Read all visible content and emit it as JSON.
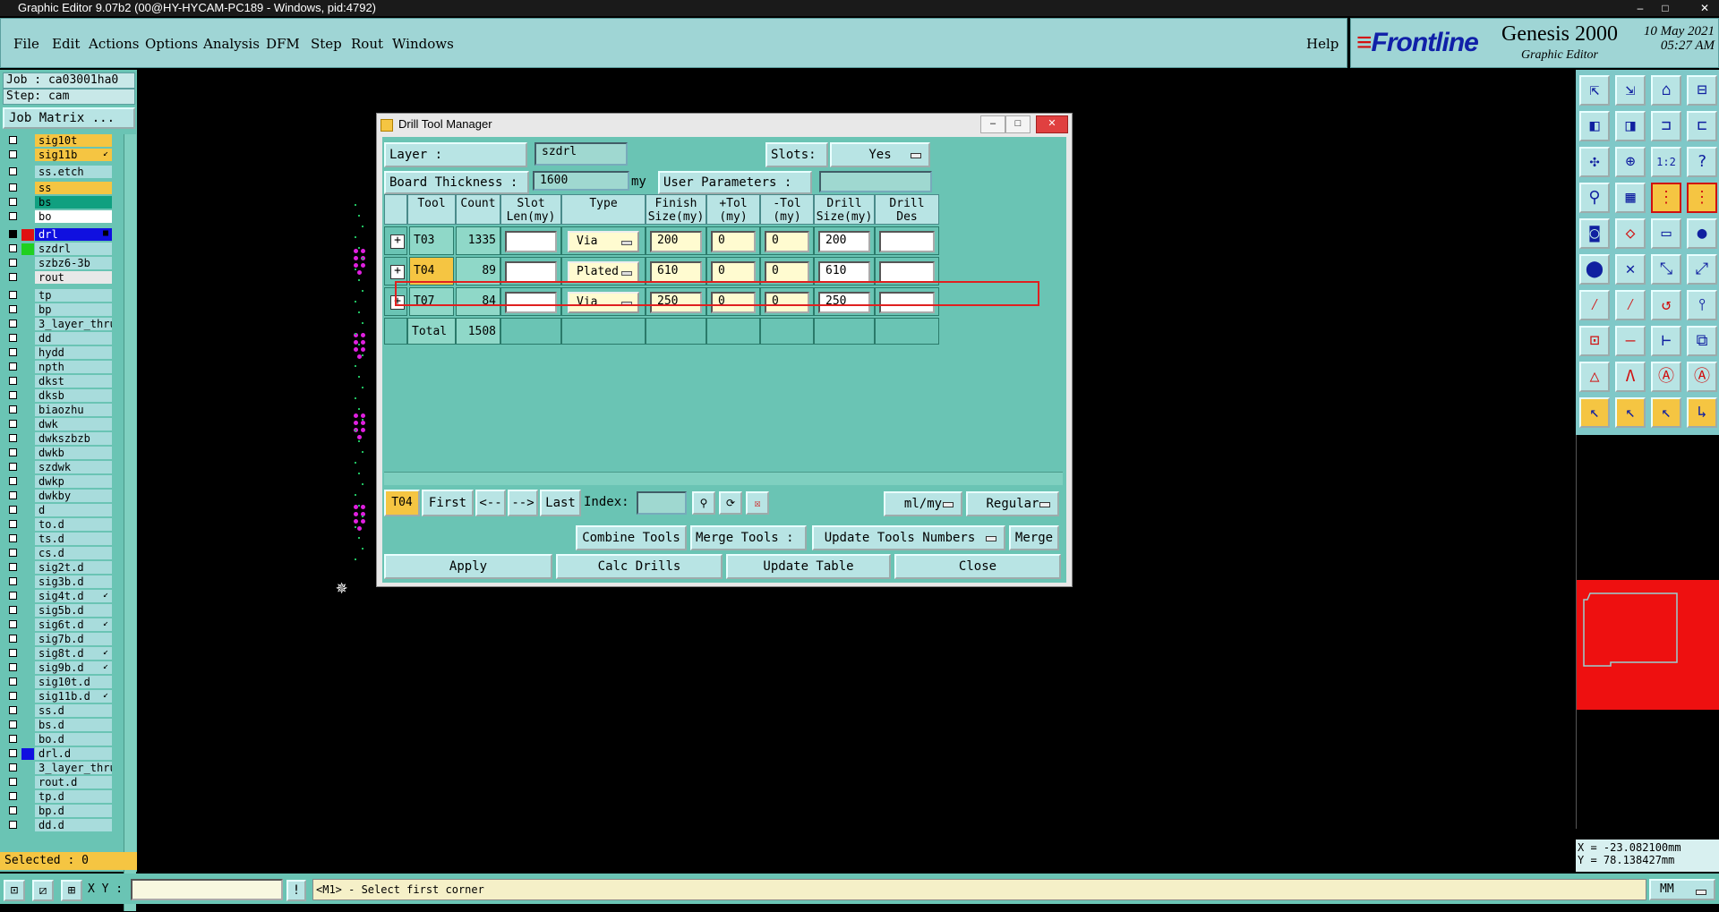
{
  "titlebar": {
    "title": "Graphic Editor 9.07b2 (00@HY-HYCAM-PC189 - Windows, pid:4792)"
  },
  "menu": [
    "File",
    "Edit",
    "Actions",
    "Options",
    "Analysis",
    "DFM",
    "Step",
    "Rout",
    "Windows"
  ],
  "help": "Help",
  "brand": {
    "frontline": "Frontline",
    "genesis": "Genesis 2000",
    "graphic_editor": "Graphic Editor",
    "date": "10 May 2021",
    "time": "05:27 AM"
  },
  "job": {
    "job_label": "Job : ca03001ha0",
    "step_label": "Step: cam",
    "job_matrix": "Job Matrix ..."
  },
  "layers": [
    {
      "name": "sig10t",
      "color": "#f5c542",
      "checked": false
    },
    {
      "name": "sig11b",
      "color": "#f5c542",
      "checked": false,
      "mark": "↙"
    },
    {
      "name": "ss.etch",
      "color": "",
      "checked": false
    },
    {
      "name": "ss",
      "color": "#f5c542",
      "checked": false
    },
    {
      "name": "bs",
      "color": "#10a080",
      "checked": false
    },
    {
      "name": "bo",
      "color": "#ffffff",
      "checked": false
    },
    {
      "name": "drl",
      "color": "#1010e0",
      "swatch": "#e01010",
      "checked": true,
      "mark": "■"
    },
    {
      "name": "szdrl",
      "color": "",
      "swatch": "#20d020",
      "checked": false
    },
    {
      "name": "szbz6-3b",
      "color": "",
      "checked": false
    },
    {
      "name": "rout",
      "color": "#e8e8e8",
      "checked": false
    },
    {
      "name": "tp",
      "color": "",
      "checked": false
    },
    {
      "name": "bp",
      "color": "",
      "checked": false
    },
    {
      "name": "3_layer_thru",
      "color": "",
      "checked": false
    },
    {
      "name": "dd",
      "color": "",
      "checked": false
    },
    {
      "name": "hydd",
      "color": "",
      "checked": false
    },
    {
      "name": "npth",
      "color": "",
      "checked": false
    },
    {
      "name": "dkst",
      "color": "",
      "checked": false
    },
    {
      "name": "dksb",
      "color": "",
      "checked": false
    },
    {
      "name": "biaozhu",
      "color": "",
      "checked": false
    },
    {
      "name": "dwk",
      "color": "",
      "checked": false
    },
    {
      "name": "dwkszbzb",
      "color": "",
      "checked": false
    },
    {
      "name": "dwkb",
      "color": "",
      "checked": false
    },
    {
      "name": "szdwk",
      "color": "",
      "checked": false
    },
    {
      "name": "dwkp",
      "color": "",
      "checked": false
    },
    {
      "name": "dwkby",
      "color": "",
      "checked": false
    },
    {
      "name": "d",
      "color": "",
      "checked": false
    },
    {
      "name": "to.d",
      "color": "",
      "checked": false
    },
    {
      "name": "ts.d",
      "color": "",
      "checked": false
    },
    {
      "name": "cs.d",
      "color": "",
      "checked": false
    },
    {
      "name": "sig2t.d",
      "color": "",
      "checked": false
    },
    {
      "name": "sig3b.d",
      "color": "",
      "checked": false
    },
    {
      "name": "sig4t.d",
      "color": "",
      "checked": false,
      "mark": "↙"
    },
    {
      "name": "sig5b.d",
      "color": "",
      "checked": false
    },
    {
      "name": "sig6t.d",
      "color": "",
      "checked": false,
      "mark": "↙"
    },
    {
      "name": "sig7b.d",
      "color": "",
      "checked": false
    },
    {
      "name": "sig8t.d",
      "color": "",
      "checked": false,
      "mark": "↙"
    },
    {
      "name": "sig9b.d",
      "color": "",
      "checked": false,
      "mark": "↙"
    },
    {
      "name": "sig10t.d",
      "color": "",
      "checked": false
    },
    {
      "name": "sig11b.d",
      "color": "",
      "checked": false,
      "mark": "↙"
    },
    {
      "name": "ss.d",
      "color": "",
      "checked": false
    },
    {
      "name": "bs.d",
      "color": "",
      "checked": false
    },
    {
      "name": "bo.d",
      "color": "",
      "checked": false
    },
    {
      "name": "drl.d",
      "color": "",
      "swatch": "#1010e0",
      "checked": false
    },
    {
      "name": "3_layer_thru",
      "color": "",
      "checked": false
    },
    {
      "name": "rout.d",
      "color": "",
      "checked": false
    },
    {
      "name": "tp.d",
      "color": "",
      "checked": false
    },
    {
      "name": "bp.d",
      "color": "",
      "checked": false
    },
    {
      "name": "dd.d",
      "color": "",
      "checked": false
    }
  ],
  "selected": "Selected : 0",
  "dialog": {
    "title": "Drill Tool Manager",
    "layer_label": "Layer          :",
    "layer_value": "szdrl",
    "slots_label": "Slots:",
    "slots_value": "Yes",
    "thickness_label": "Board Thickness :",
    "thickness_value": "1600",
    "thickness_unit": "my",
    "user_params_label": "User Parameters :",
    "headers": [
      "",
      "Tool",
      "Count",
      "Slot\nLen(my)",
      "Type",
      "Finish\nSize(my)",
      "+Tol\n(my)",
      "-Tol\n(my)",
      "Drill\nSize(my)",
      "Drill\nDes"
    ],
    "rows": [
      {
        "tool": "T03",
        "count": "1335",
        "slot": "",
        "type": "Via",
        "finish": "200",
        "ptol": "0",
        "mtol": "0",
        "drill": "200",
        "des": "",
        "selected": false
      },
      {
        "tool": "T04",
        "count": "89",
        "slot": "",
        "type": "Plated",
        "finish": "610",
        "ptol": "0",
        "mtol": "0",
        "drill": "610",
        "des": "",
        "selected": true
      },
      {
        "tool": "T07",
        "count": "84",
        "slot": "",
        "type": "Via",
        "finish": "250",
        "ptol": "0",
        "mtol": "0",
        "drill": "250",
        "des": "",
        "selected": false
      }
    ],
    "total_label": "Total",
    "total_count": "1508",
    "current_tool": "T04",
    "nav": {
      "first": "First",
      "prev": "<--",
      "next": "-->",
      "last": "Last",
      "index_label": "Index:"
    },
    "units_option": "ml/my",
    "mode_option": "Regular",
    "combine_tools": "Combine Tools",
    "merge_tools_label": "Merge Tools :",
    "update_tools_numbers": "Update Tools Numbers",
    "merge": "Merge",
    "apply": "Apply",
    "calc_drills": "Calc Drills",
    "update_table": "Update Table",
    "close": "Close"
  },
  "coords": {
    "x": "X = -23.082100mm",
    "y": "Y = 78.138427mm"
  },
  "statusbar": {
    "xy_label": "X Y :",
    "prompt": "<M1> - Select first corner",
    "units": "MM"
  },
  "toolbar_icons": [
    "zoom-home-icon",
    "zoom-back-icon",
    "home-icon",
    "window-icon",
    "pan-left-icon",
    "pan-right-icon",
    "snap-icon",
    "split-icon",
    "fit-icon",
    "center-icon",
    "scale-icon",
    "help-icon",
    "measure-icon",
    "grid-icon",
    "net-icon",
    "net-red-icon",
    "camera-icon",
    "shape-icon",
    "ruler-icon",
    "pad-icon",
    "connect-icon",
    "cross-icon",
    "link-icon",
    "link2-icon",
    "line-icon",
    "line-red-icon",
    "arc-icon",
    "split-line-icon",
    "point-icon",
    "minus-icon",
    "move-icon",
    "copy-icon",
    "triangle-icon",
    "angle-icon",
    "arch-icon",
    "arch2-icon",
    "cursor-icon",
    "cursor-sel-icon",
    "cursor-fill-icon",
    "cursor-step-icon"
  ]
}
